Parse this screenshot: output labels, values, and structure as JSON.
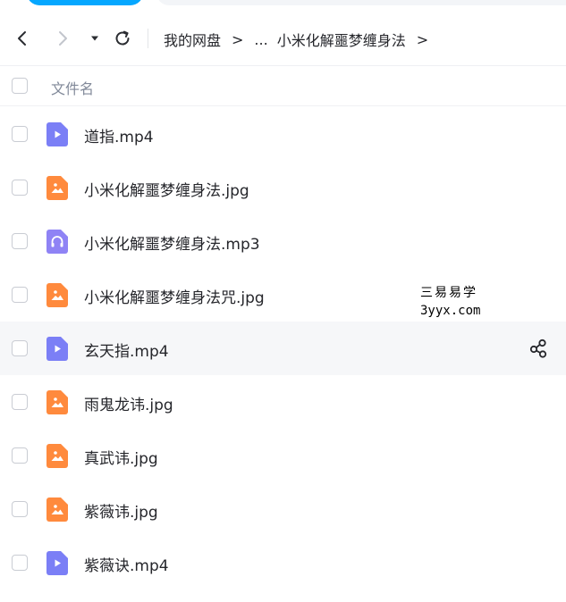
{
  "nav": {
    "breadcrumb": [
      "我的网盘",
      "...",
      "小米化解噩梦缠身法"
    ],
    "separator": ">"
  },
  "header": {
    "column_label": "文件名"
  },
  "files": [
    {
      "name": "道指.mp4",
      "type": "video",
      "icon": "video-file-icon"
    },
    {
      "name": "小米化解噩梦缠身法.jpg",
      "type": "image",
      "icon": "image-file-icon"
    },
    {
      "name": "小米化解噩梦缠身法.mp3",
      "type": "audio",
      "icon": "audio-file-icon"
    },
    {
      "name": "小米化解噩梦缠身法咒.jpg",
      "type": "image",
      "icon": "image-file-icon"
    },
    {
      "name": "玄天指.mp4",
      "type": "video",
      "icon": "video-file-icon",
      "hovered": true
    },
    {
      "name": "雨鬼龙讳.jpg",
      "type": "image",
      "icon": "image-file-icon"
    },
    {
      "name": "真武讳.jpg",
      "type": "image",
      "icon": "image-file-icon"
    },
    {
      "name": "紫薇讳.jpg",
      "type": "image",
      "icon": "image-file-icon"
    },
    {
      "name": "紫薇诀.mp4",
      "type": "video",
      "icon": "video-file-icon"
    }
  ],
  "watermark": {
    "line1": "三易易学",
    "line2": "3yyx.com"
  },
  "colors": {
    "video": "#7b7ff6",
    "image": "#ff8a3d",
    "audio": "#8f83f5",
    "accent": "#06a7ff"
  }
}
